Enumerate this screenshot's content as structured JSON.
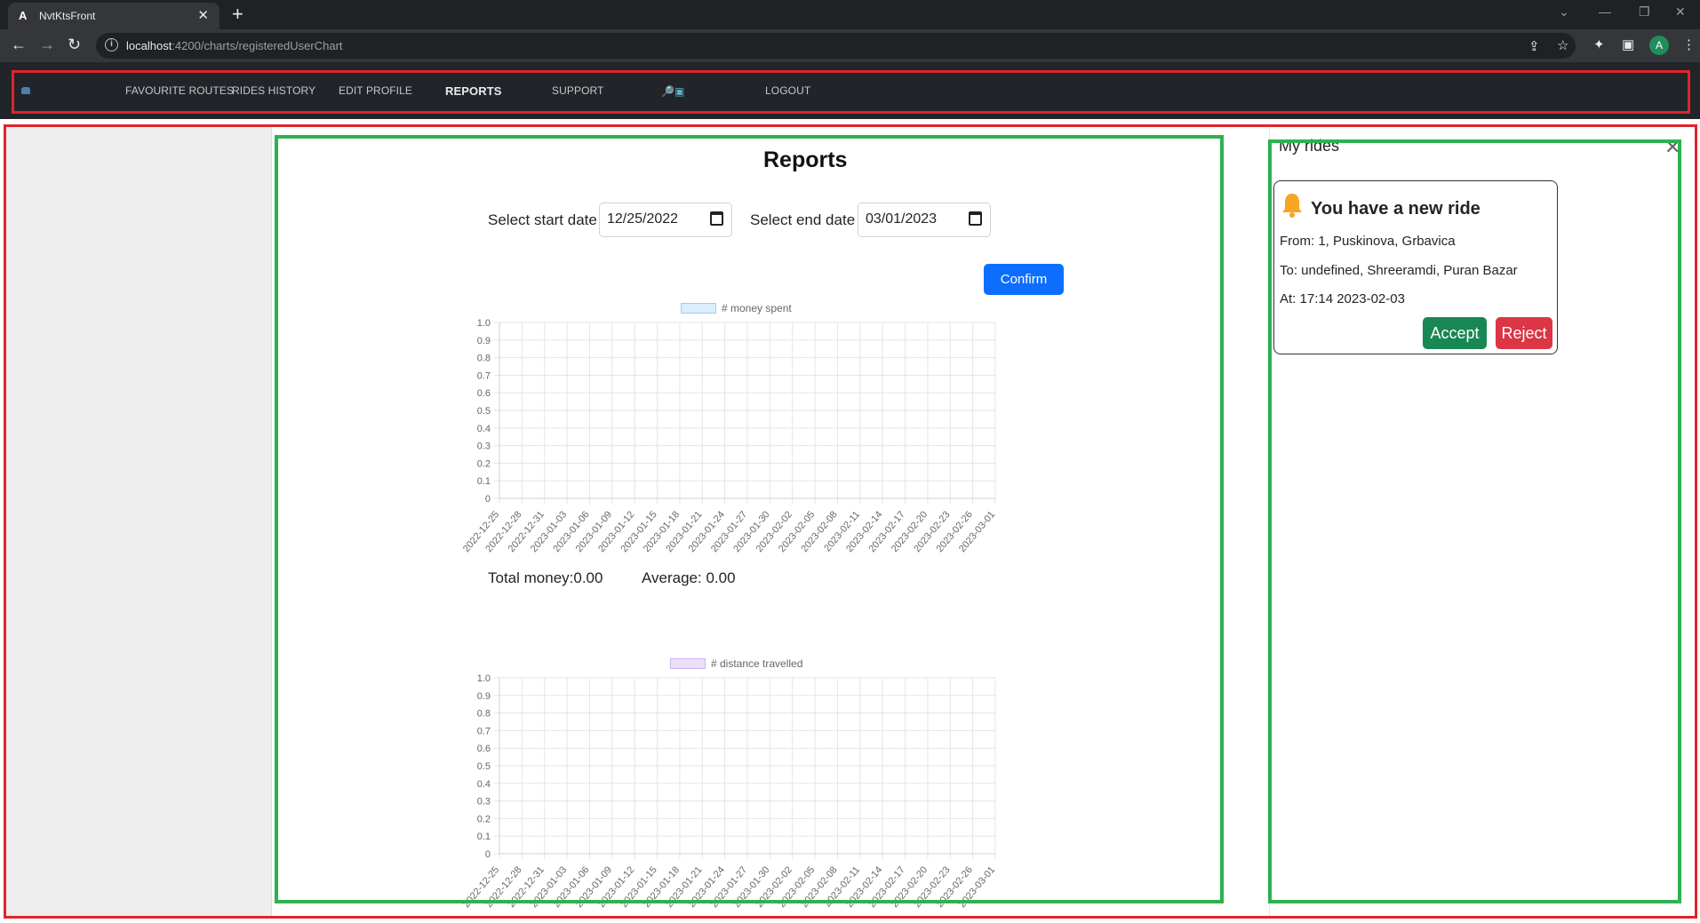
{
  "browser": {
    "tab_title": "NvtKtsFront",
    "tab_favicon": "A",
    "url_host": "localhost",
    "url_path": ":4200/charts/registeredUserChart",
    "avatar_letter": "A"
  },
  "navbar": {
    "links": [
      "FAVOURITE ROUTES",
      "RIDES HISTORY",
      "EDIT PROFILE",
      "REPORTS",
      "SUPPORT",
      "LOGOUT"
    ],
    "active": "REPORTS",
    "tools_icons": [
      "search-icon",
      "chat-icon"
    ]
  },
  "reports": {
    "title": "Reports",
    "start_label": "Select start date",
    "start_value": "12/25/2022",
    "end_label": "Select end date",
    "end_value": "03/01/2023",
    "confirm_label": "Confirm",
    "total_money": "Total money:0.00",
    "average": "Average: 0.00"
  },
  "chart_data": [
    {
      "type": "bar",
      "legend": "# money spent",
      "legend_color": "#9ad0f5",
      "categories": [
        "2022-12-25",
        "2022-12-28",
        "2022-12-31",
        "2023-01-03",
        "2023-01-06",
        "2023-01-09",
        "2023-01-12",
        "2023-01-15",
        "2023-01-18",
        "2023-01-21",
        "2023-01-24",
        "2023-01-27",
        "2023-01-30",
        "2023-02-02",
        "2023-02-05",
        "2023-02-08",
        "2023-02-11",
        "2023-02-14",
        "2023-02-17",
        "2023-02-20",
        "2023-02-23",
        "2023-02-26",
        "2023-03-01"
      ],
      "values": [
        0,
        0,
        0,
        0,
        0,
        0,
        0,
        0,
        0,
        0,
        0,
        0,
        0,
        0,
        0,
        0,
        0,
        0,
        0,
        0,
        0,
        0,
        0
      ],
      "yticks": [
        "1.0",
        "0.9",
        "0.8",
        "0.7",
        "0.6",
        "0.5",
        "0.4",
        "0.3",
        "0.2",
        "0.1",
        "0"
      ],
      "ylim": [
        0,
        1
      ],
      "grid": true,
      "legend_position": "top"
    },
    {
      "type": "bar",
      "legend": "# distance travelled",
      "legend_color": "#c9b3f0",
      "categories": [
        "2022-12-25",
        "2022-12-28",
        "2022-12-31",
        "2023-01-03",
        "2023-01-06",
        "2023-01-09",
        "2023-01-12",
        "2023-01-15",
        "2023-01-18",
        "2023-01-21",
        "2023-01-24",
        "2023-01-27",
        "2023-01-30",
        "2023-02-02",
        "2023-02-05",
        "2023-02-08",
        "2023-02-11",
        "2023-02-14",
        "2023-02-17",
        "2023-02-20",
        "2023-02-23",
        "2023-02-26",
        "2023-03-01"
      ],
      "values": [
        0,
        0,
        0,
        0,
        0,
        0,
        0,
        0,
        0,
        0,
        0,
        0,
        0,
        0,
        0,
        0,
        0,
        0,
        0,
        0,
        0,
        0,
        0
      ],
      "yticks": [
        "1.0",
        "0.9",
        "0.8",
        "0.7",
        "0.6",
        "0.5",
        "0.4",
        "0.3",
        "0.2",
        "0.1",
        "0"
      ],
      "ylim": [
        0,
        1
      ],
      "grid": true,
      "legend_position": "top"
    }
  ],
  "rides": {
    "title": "My rides",
    "card_title": "You have a new ride",
    "from": "From: 1, Puskinova, Grbavica",
    "to": "To: undefined, Shreeramdi, Puran Bazar",
    "at": "At: 17:14 2023-02-03",
    "accept_label": "Accept",
    "reject_label": "Reject"
  },
  "colors": {
    "navbar_bg": "#212529",
    "primary": "#0d6efd",
    "success": "#198754",
    "danger": "#dc3545",
    "highlight_red": "#e0242b",
    "highlight_green": "#2cb24f"
  }
}
